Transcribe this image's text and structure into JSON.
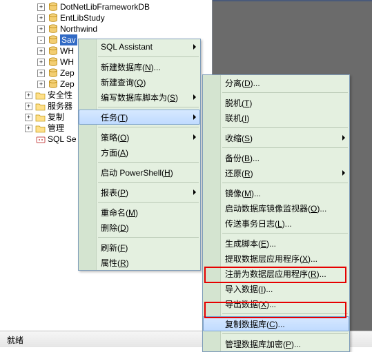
{
  "tree": {
    "items": [
      {
        "indent": 48,
        "exp": "+",
        "icon": "db",
        "label": "DotNetLibFrameworkDB"
      },
      {
        "indent": 48,
        "exp": "+",
        "icon": "db",
        "label": "EntLibStudy"
      },
      {
        "indent": 48,
        "exp": "+",
        "icon": "db",
        "label": "Northwind"
      },
      {
        "indent": 48,
        "exp": "-",
        "icon": "db",
        "label": "Sav",
        "selected": true
      },
      {
        "indent": 48,
        "exp": "+",
        "icon": "db",
        "label": "WH"
      },
      {
        "indent": 48,
        "exp": "+",
        "icon": "db",
        "label": "WH"
      },
      {
        "indent": 48,
        "exp": "+",
        "icon": "db",
        "label": "Zep"
      },
      {
        "indent": 48,
        "exp": "+",
        "icon": "db",
        "label": "Zep"
      },
      {
        "indent": 30,
        "exp": "+",
        "icon": "folder",
        "label": "安全性"
      },
      {
        "indent": 30,
        "exp": "+",
        "icon": "folder",
        "label": "服务器"
      },
      {
        "indent": 30,
        "exp": "+",
        "icon": "folder",
        "label": "复制"
      },
      {
        "indent": 30,
        "exp": "+",
        "icon": "folder",
        "label": "管理"
      },
      {
        "indent": 30,
        "exp": "",
        "icon": "agent",
        "label": "SQL Se"
      }
    ]
  },
  "menu1": {
    "items": [
      {
        "label": "SQL Assistant",
        "arrow": true
      },
      "sep",
      {
        "label": "新建数据库(N)..."
      },
      {
        "label": "新建查询(Q)"
      },
      {
        "label": "编写数据库脚本为(S)",
        "arrow": true
      },
      "sep",
      {
        "label": "任务(T)",
        "arrow": true,
        "hover": true
      },
      "sep",
      {
        "label": "策略(O)",
        "arrow": true
      },
      {
        "label": "方面(A)"
      },
      "sep",
      {
        "label": "启动 PowerShell(H)"
      },
      "sep",
      {
        "label": "报表(P)",
        "arrow": true
      },
      "sep",
      {
        "label": "重命名(M)"
      },
      {
        "label": "删除(D)"
      },
      "sep",
      {
        "label": "刷新(F)"
      },
      {
        "label": "属性(R)"
      }
    ]
  },
  "menu2": {
    "items": [
      {
        "label": "分离(D)..."
      },
      "sep",
      {
        "label": "脱机(T)"
      },
      {
        "label": "联机(I)"
      },
      "sep",
      {
        "label": "收缩(S)",
        "arrow": true
      },
      "sep",
      {
        "label": "备份(B)..."
      },
      {
        "label": "还原(R)",
        "arrow": true
      },
      "sep",
      {
        "label": "镜像(M)..."
      },
      {
        "label": "启动数据库镜像监视器(O)..."
      },
      {
        "label": "传送事务日志(L)..."
      },
      "sep",
      {
        "label": "生成脚本(E)..."
      },
      {
        "label": "提取数据层应用程序(X)..."
      },
      {
        "label": "注册为数据层应用程序(R)..."
      },
      {
        "label": "导入数据(I)..."
      },
      {
        "label": "导出数据(X)..."
      },
      "sep",
      {
        "label": "复制数据库(C)...",
        "hover": true
      },
      "sep",
      {
        "label": "管理数据库加密(P)..."
      }
    ]
  },
  "statusbar": {
    "text": "就绪"
  }
}
